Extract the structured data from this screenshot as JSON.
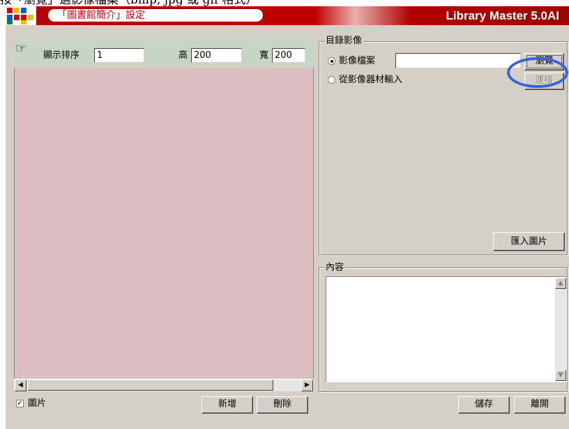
{
  "page_caption": "按「瀏覽」選影像檔案（bmp, jpg 或 gif 格式）",
  "window": {
    "title": "「圖書館簡介」設定",
    "brand": "Library Master 5.0AI"
  },
  "image_panel": {
    "sort_label": "顯示排序",
    "sort_value": "1",
    "height_label": "高",
    "height_value": "200",
    "width_label": "寬",
    "width_value": "200"
  },
  "catalog_image": {
    "legend": "目錄影像",
    "options": [
      {
        "label": "影像檔案",
        "selected": true
      },
      {
        "label": "從影像器材輸入",
        "selected": false
      }
    ],
    "file_value": "",
    "browse_label": "瀏覽",
    "connect_label": "連接",
    "import_label": "匯入圖片"
  },
  "content": {
    "legend": "內容",
    "value": ""
  },
  "footer": {
    "picture_checkbox_label": "圖片",
    "picture_checked": true,
    "add_label": "新增",
    "delete_label": "刪除",
    "save_label": "儲存",
    "leave_label": "離開"
  },
  "colors": {
    "titlebar": "#b30000",
    "panel_bg": "#dcbfc2",
    "panel_header": "#c8d4c4",
    "highlight_circle": "#3b63d9"
  }
}
